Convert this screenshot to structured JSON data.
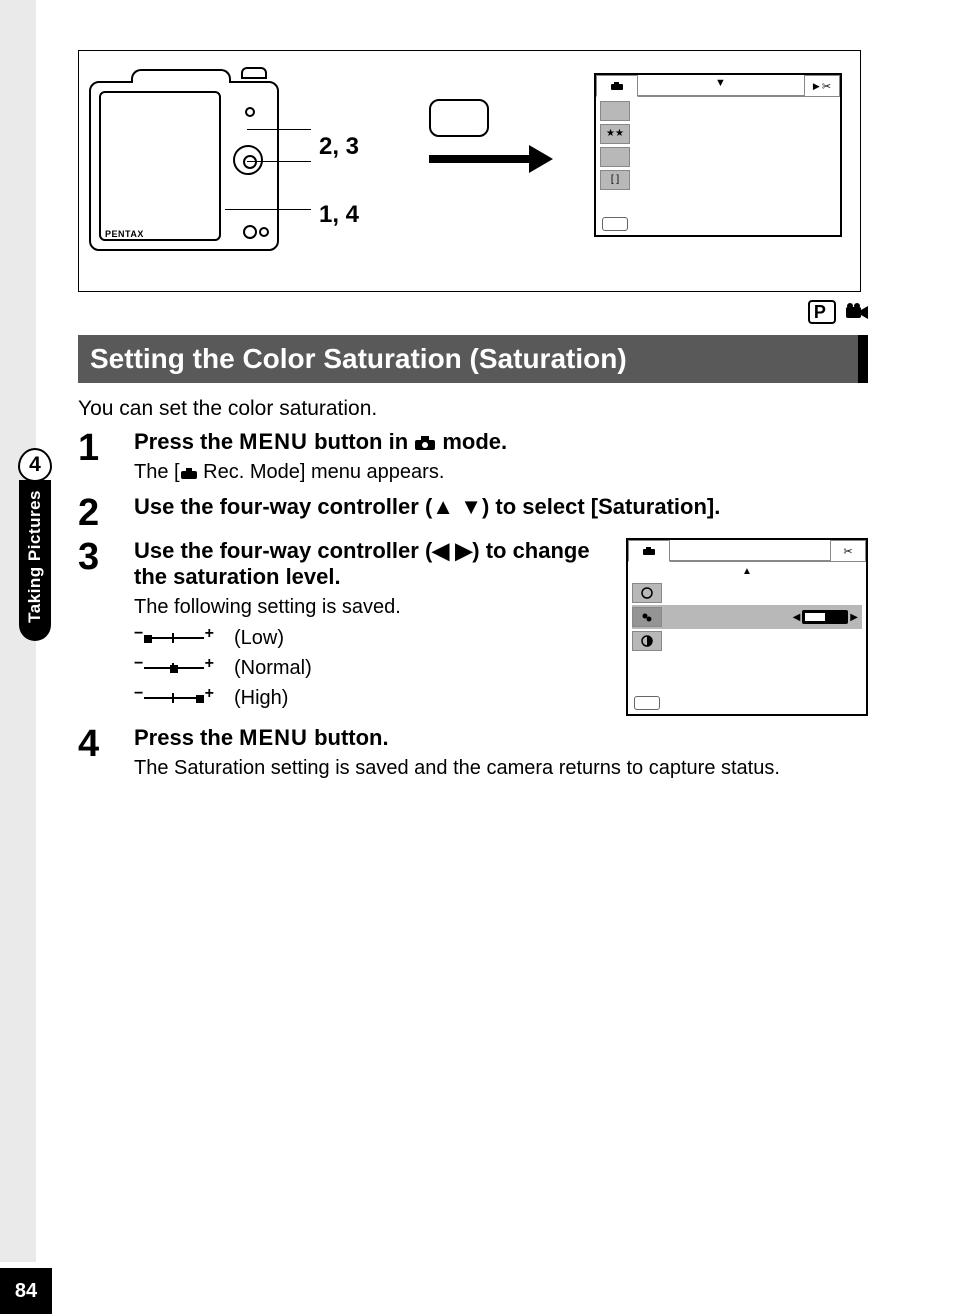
{
  "page_number": "84",
  "sidebar": {
    "chapter": "4",
    "label": "Taking Pictures"
  },
  "illustration": {
    "brand": "PENTAX",
    "label_top": "2, 3",
    "label_bottom": "1, 4",
    "screen1": {
      "tab_left_icon": "camera-icon",
      "tab_right_icon": "tools-icon",
      "rows": [
        {
          "icon": ""
        },
        {
          "icon": "★★"
        },
        {
          "icon": ""
        },
        {
          "icon": "[ ]"
        }
      ]
    }
  },
  "mode_row": {
    "p_label": "P",
    "movie_icon": "movie-icon"
  },
  "title": "Setting the Color Saturation (Saturation)",
  "intro": "You can set the color saturation.",
  "steps": {
    "s1": {
      "num": "1",
      "title_pre": "Press the ",
      "menu_word": "MENU",
      "title_mid": " button in ",
      "title_post": " mode.",
      "sub_pre": "The [",
      "sub_post": " Rec. Mode] menu appears."
    },
    "s2": {
      "num": "2",
      "title_pre": "Use the four-way controller (",
      "title_post": ") to select [Saturation]."
    },
    "s3": {
      "num": "3",
      "title_pre": "Use the four-way controller (",
      "title_post": ") to change the saturation level.",
      "sub": "The following setting is saved.",
      "levels": [
        {
          "pos": "low",
          "label": "(Low)"
        },
        {
          "pos": "mid",
          "label": "(Normal)"
        },
        {
          "pos": "high",
          "label": "(High)"
        }
      ]
    },
    "s4": {
      "num": "4",
      "title_pre": "Press the ",
      "menu_word": "MENU",
      "title_post": " button.",
      "sub": "The Saturation setting is saved and the camera returns to capture status."
    }
  },
  "screen2": {
    "rows": [
      {
        "icon": "sharpness-icon"
      },
      {
        "icon": "saturation-icon",
        "selected": true
      },
      {
        "icon": "contrast-icon"
      }
    ]
  }
}
